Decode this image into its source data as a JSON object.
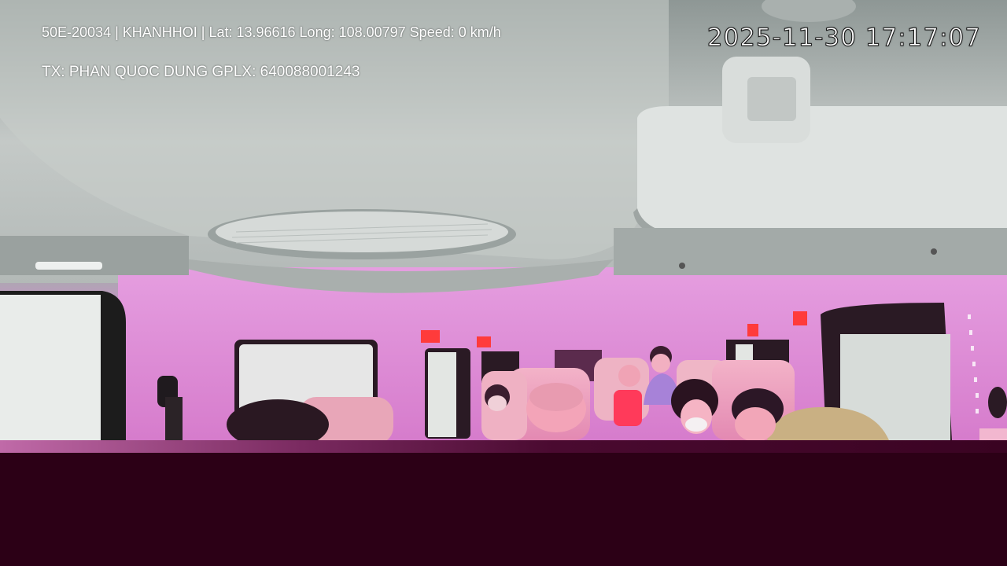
{
  "osd": {
    "line1": "50E-20034 | KHANHHOI | Lat: 13.96616 Long: 108.00797 Speed: 0 km/h",
    "line2": "TX: PHAN QUOC DUNG GPLX: 640088001243",
    "timestamp": "2025-11-30 17:17:07"
  },
  "colors": {
    "background": "#2c0016",
    "overlay_text": "#ffffff",
    "cabin_tint": "#dd86d5",
    "ceiling": "#b7bdbb"
  }
}
